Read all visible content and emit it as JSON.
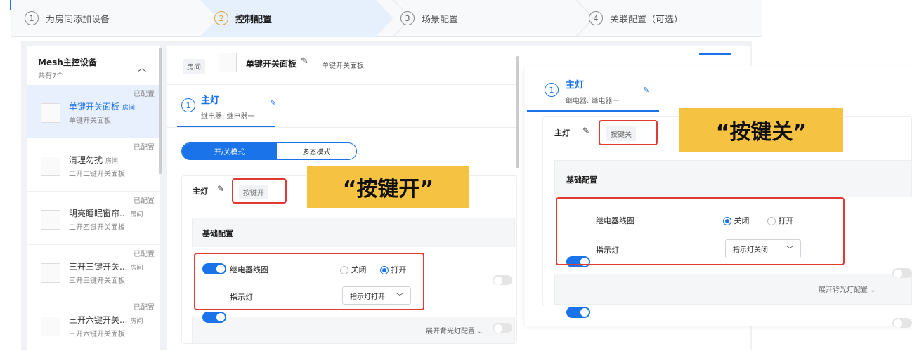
{
  "steps": [
    {
      "num": "1",
      "label": "为房间添加设备"
    },
    {
      "num": "2",
      "label": "控制配置"
    },
    {
      "num": "3",
      "label": "场景配置"
    },
    {
      "num": "4",
      "label": "关联配置（可选）"
    }
  ],
  "sidebar": {
    "title": "Mesh主控设备",
    "count": "共有7个",
    "items": [
      {
        "status": "已配置",
        "name": "单键开关面板",
        "room": "房间",
        "sub": "单键开关面板"
      },
      {
        "status": "已配置",
        "name": "清理勿扰",
        "room": "房间",
        "sub": "二开二键开关面板"
      },
      {
        "status": "已配置",
        "name": "明亮睡眠窗帘...",
        "room": "房间",
        "sub": "二开四键开关面板"
      },
      {
        "status": "已配置",
        "name": "三开三键开关...",
        "room": "房间",
        "sub": "三开三键开关面板"
      },
      {
        "status": "已配置",
        "name": "三开六键开关...",
        "room": "房间",
        "sub": "三开六键开关面板"
      }
    ]
  },
  "device": {
    "room_tag": "房间",
    "name": "单键开关面板",
    "type": "单键开关面板"
  },
  "tab": {
    "num": "1",
    "title": "主灯",
    "subtitle": "继电器: 继电器一"
  },
  "modes": {
    "on_off": "开/关模式",
    "multi": "多态模式"
  },
  "key_on": {
    "label": "主灯",
    "tag": "按键开"
  },
  "key_off": {
    "label": "主灯",
    "tag": "按键关"
  },
  "basic_config": "基础配置",
  "relay": {
    "label": "继电器线圈",
    "opt_close": "关闭",
    "opt_open": "打开"
  },
  "indicator": {
    "label": "指示灯",
    "value_on": "指示灯打开",
    "value_off": "指示灯关闭"
  },
  "expand": "展开背光灯配置",
  "callouts": {
    "on": "“按键开”",
    "off": "“按键关”"
  }
}
